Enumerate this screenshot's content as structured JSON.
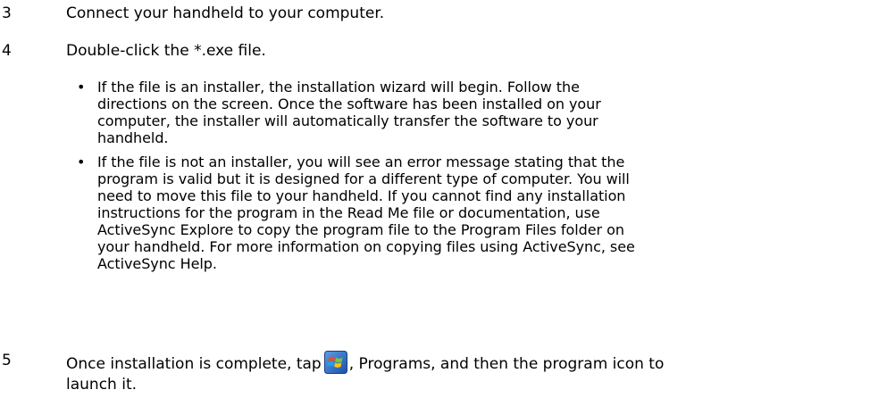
{
  "steps": [
    {
      "number": "3",
      "text": "Connect your handheld to your computer."
    },
    {
      "number": "4",
      "text": "Double-click the *.exe file.",
      "bullets": [
        {
          "lines": [
            "If the file is an installer, the installation wizard will begin. Follow the",
            "directions on the screen. Once the software has been installed on your",
            "computer, the installer will automatically transfer the software to your",
            "handheld."
          ]
        },
        {
          "lines": [
            "If the file is not an installer, you will see an error message stating that the",
            "program is valid but it is designed for a different type of computer. You will",
            "need to move this file to your handheld. If you cannot find any installation",
            "instructions for the program in the Read Me file or documentation, use",
            "ActiveSync Explore to copy the program file to the Program Files folder on",
            "your handheld. For more information on copying files using ActiveSync, see",
            "ActiveSync Help."
          ]
        }
      ]
    },
    {
      "number": "5",
      "text_before_icon": "Once installation is complete, tap",
      "icon": "windows-start-icon",
      "text_after_icon": ", Programs, and then the program icon to",
      "text_line2": "launch it."
    }
  ],
  "bullet_glyph": "•",
  "colors": {
    "text": "#000000",
    "background": "#ffffff"
  }
}
